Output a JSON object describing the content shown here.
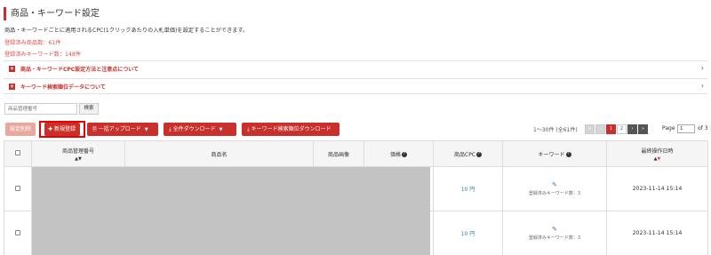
{
  "page": {
    "title": "商品・キーワード設定",
    "description": "商品・キーワードごとに適用されるCPC(1クリックあたりの入札単価)を設定することができます。",
    "registered_products": "登録済み商品数：61件",
    "registered_keywords": "登録済みキーワード数：148件"
  },
  "accordions": [
    {
      "label": "商品・キーワードCPC設定方法と注意点について"
    },
    {
      "label": "キーワード検索順位データについて"
    }
  ],
  "search": {
    "placeholder": "商品管理番号",
    "button_label": "検索"
  },
  "toolbar": {
    "delete_label": "設定削除",
    "new_label": "新規登録",
    "bulk_upload_label": "一括アップロード",
    "download_all_label": "全件ダウンロード",
    "keyword_rank_download_label": "キーワード検索順位ダウンロード"
  },
  "pagination": {
    "info": "1〜30件 (全61件)",
    "first": "«",
    "prev": "‹",
    "pages": [
      "1",
      "2"
    ],
    "next": "›",
    "last": "»",
    "page_label": "Page",
    "current_page": "1",
    "of_label": "of 3"
  },
  "table": {
    "headers": {
      "product_id": "商品管理番号",
      "product_name": "商品名",
      "product_image": "商品画像",
      "price": "価格",
      "cpc": "商品CPC",
      "keyword": "キーワード",
      "last_updated": "最終操作日時"
    },
    "rows": [
      {
        "cpc": "10 円",
        "keyword_count": "登録済みキーワード数：3",
        "date": "2023-11-14 15:14"
      },
      {
        "cpc": "10 円",
        "keyword_count": "登録済みキーワード数：3",
        "date": "2023-11-14 15:14"
      }
    ]
  },
  "icons": {
    "accordion_expand": "plus-icon",
    "accordion_chevron": "chevron-right-icon",
    "help": "question-circle-icon",
    "edit": "edit-icon",
    "upload": "file-upload-icon",
    "download": "download-icon"
  },
  "colors": {
    "accent": "#c9302c",
    "accent_light": "#e8a89e",
    "link": "#337ab7",
    "highlight_box": "#ee0000",
    "count_text": "#d9534f"
  }
}
